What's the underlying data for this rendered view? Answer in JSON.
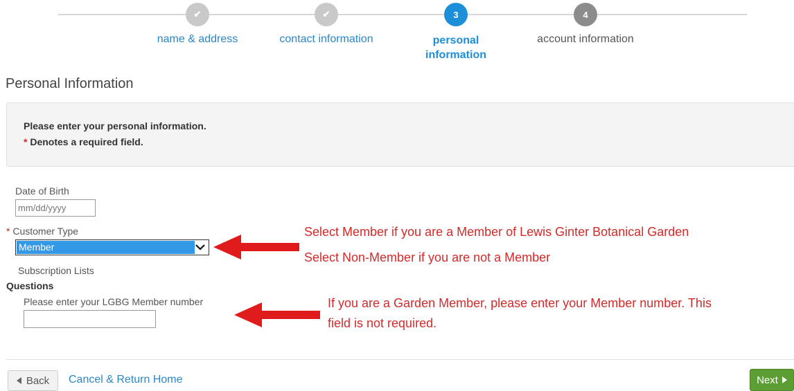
{
  "stepper": {
    "steps": [
      {
        "marker": "✔",
        "label": "name & address",
        "state": "done"
      },
      {
        "marker": "✔",
        "label": "contact information",
        "state": "done"
      },
      {
        "marker": "3",
        "label_line1": "personal",
        "label_line2": "information",
        "state": "active"
      },
      {
        "marker": "4",
        "label": "account information",
        "state": "future"
      }
    ]
  },
  "page": {
    "title": "Personal Information"
  },
  "info": {
    "line1": "Please enter your personal information.",
    "required_mark": "*",
    "line2": " Denotes a required field."
  },
  "form": {
    "dob": {
      "label": "Date of Birth",
      "placeholder": "mm/dd/yyyy"
    },
    "customer_type": {
      "required_mark": "*",
      "label": "Customer Type",
      "value": "Member"
    },
    "subscription_label": "Subscription Lists",
    "questions_label": "Questions",
    "member_number": {
      "label": "Please enter your LGBG Member number",
      "value": ""
    }
  },
  "annotations": {
    "customer_line1": "Select Member if you are a Member of Lewis Ginter Botanical Garden",
    "customer_line2": "Select Non-Member if you are not a Member",
    "member_line1": "If you are a Garden Member, please enter your Member number.  This",
    "member_line2": "field is not required."
  },
  "footer": {
    "back_label": "Back",
    "cancel_label": "Cancel & Return Home",
    "next_label": "Next"
  },
  "colors": {
    "accent": "#1d8fd8",
    "link": "#2b86c6",
    "annotation": "#d42a2a",
    "next_button": "#5d9e34"
  }
}
